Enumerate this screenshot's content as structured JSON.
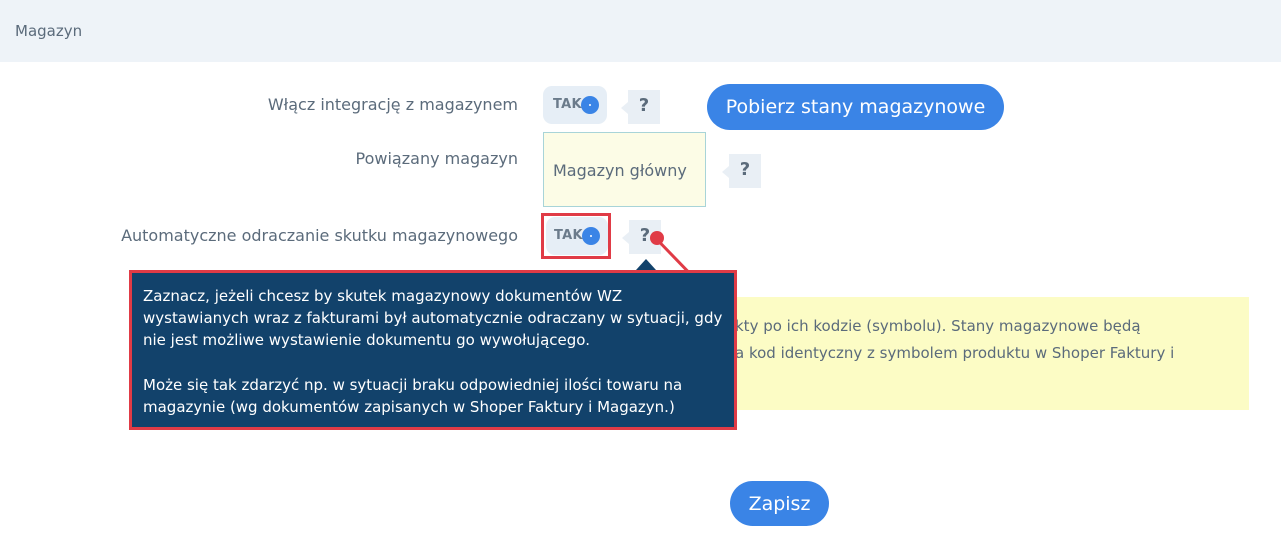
{
  "header": {
    "title": "Magazyn"
  },
  "form": {
    "integration": {
      "label": "Włącz integrację z magazynem",
      "toggle": "TAK",
      "help": "?"
    },
    "fetch_button": "Pobierz stany magazynowe",
    "warehouse": {
      "label": "Powiązany magazyn",
      "value": "Magazyn główny",
      "help": "?"
    },
    "auto_defer": {
      "label": "Automatyczne odraczanie skutku magazynowego",
      "toggle": "TAK",
      "help": "?"
    }
  },
  "tooltip": {
    "lines": [
      "Zaznacz, jeżeli chcesz by skutek magazynowy dokumentów WZ",
      "wystawianych wraz z fakturami był automatycznie odraczany w sytuacji, gdy",
      "nie jest możliwe wystawienie dokumentu go wywołującego.",
      "Może się tak zdarzyć np. w sytuacji braku odpowiedniej ilości towaru na",
      "magazynie (wg dokumentów zapisanych w Shoper Faktury i Magazyn.)"
    ]
  },
  "info": {
    "lines": [
      "kty po ich kodzie (symbolu). Stany magazynowe będą",
      "a kod identyczny z symbolem produktu w Shoper Faktury i"
    ]
  },
  "save_button": "Zapisz",
  "colors": {
    "accent": "#3a84e6",
    "tooltip_bg": "#12426b",
    "highlight": "#e03b46",
    "info_bg": "#fcfcc5"
  }
}
